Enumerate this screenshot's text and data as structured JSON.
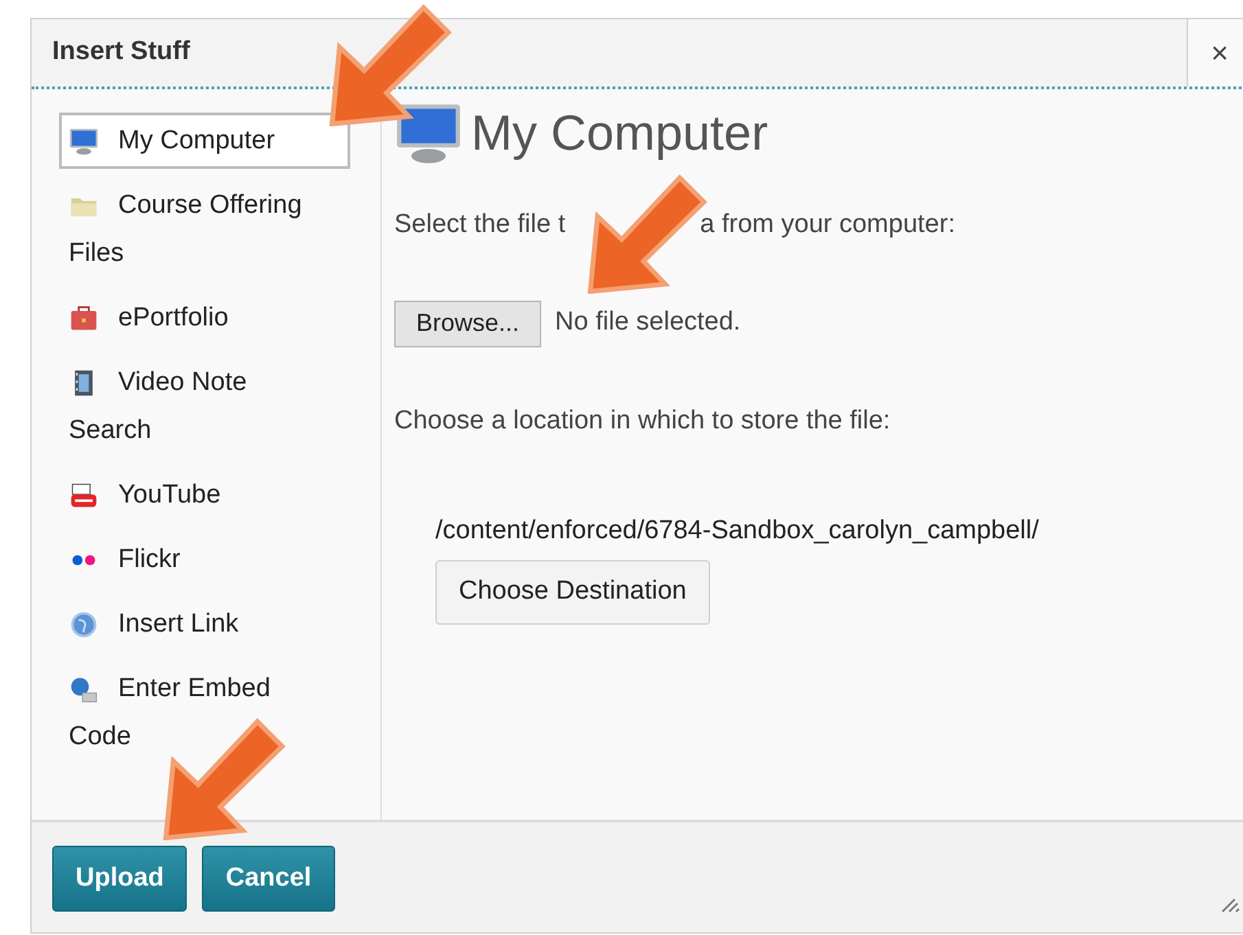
{
  "dialog": {
    "title": "Insert Stuff",
    "close": "×"
  },
  "sidebar": {
    "items": [
      {
        "kind": "computer",
        "label": "My Computer",
        "selected": true
      },
      {
        "kind": "folder",
        "label": "Course Offering Files",
        "selected": false
      },
      {
        "kind": "briefcase",
        "label": "ePortfolio",
        "selected": false
      },
      {
        "kind": "film",
        "label": "Video Note Search",
        "selected": false
      },
      {
        "kind": "video",
        "label": "YouTube",
        "selected": false
      },
      {
        "kind": "dots",
        "label": "Flickr",
        "selected": false
      },
      {
        "kind": "globe",
        "label": "Insert Link",
        "selected": false
      },
      {
        "kind": "embed",
        "label": "Enter Embed Code",
        "selected": false
      }
    ]
  },
  "main": {
    "heading": "My Computer",
    "select_prompt": [
      "Select the file t",
      "a from your computer:"
    ],
    "browse_button": "Browse...",
    "file_status": "No file selected.",
    "location_prompt": "Choose a location in which to store the file:",
    "path": "/content/enforced/6784-Sandbox_carolyn_campbell/",
    "destination_button": "Choose Destination"
  },
  "footer": {
    "buttons": [
      "Upload",
      "Cancel"
    ]
  },
  "annotations": [
    {
      "kind": "arrow"
    },
    {
      "kind": "arrow"
    },
    {
      "kind": "arrow"
    }
  ]
}
